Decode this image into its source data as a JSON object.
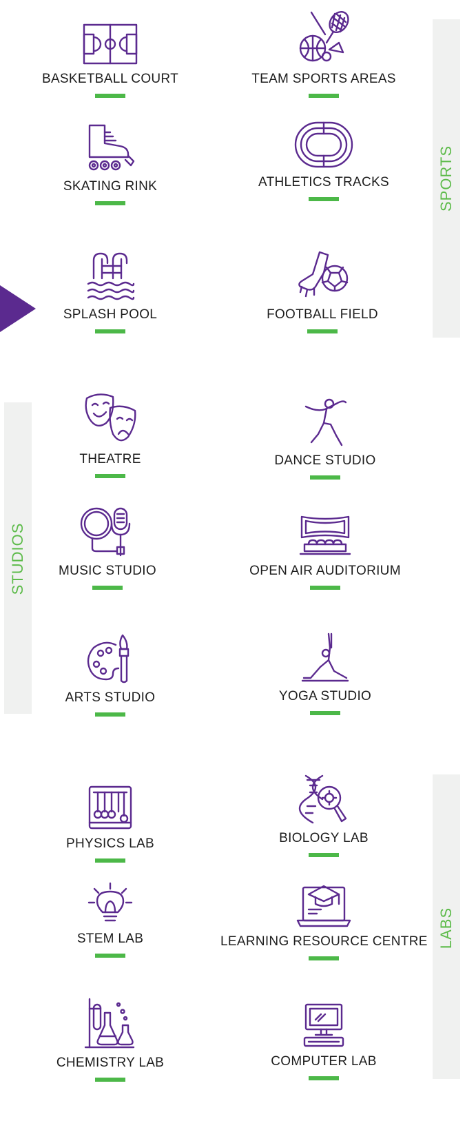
{
  "sections": {
    "sports": "SPORTS",
    "studios": "STUDIOS",
    "labs": "LABS"
  },
  "facilities": {
    "basketball_court": "BASKETBALL COURT",
    "team_sports_areas": "TEAM SPORTS AREAS",
    "skating_rink": "SKATING RINK",
    "athletics_tracks": "ATHLETICS TRACKS",
    "splash_pool": "SPLASH POOL",
    "football_field": "FOOTBALL FIELD",
    "theatre": "THEATRE",
    "dance_studio": "DANCE STUDIO",
    "music_studio": "MUSIC STUDIO",
    "open_air_auditorium": "OPEN AIR AUDITORIUM",
    "arts_studio": "ARTS STUDIO",
    "yoga_studio": "YOGA STUDIO",
    "physics_lab": "PHYSICS LAB",
    "biology_lab": "BIOLOGY LAB",
    "stem_lab": "STEM LAB",
    "learning_resource_centre": "LEARNING RESOURCE CENTRE",
    "chemistry_lab": "CHEMISTRY LAB",
    "computer_lab": "COMPUTER LAB"
  },
  "icons": {
    "basketball_court": "basketball-court-icon",
    "team_sports_areas": "sports-equipment-icon",
    "skating_rink": "roller-skate-icon",
    "athletics_tracks": "running-track-icon",
    "splash_pool": "pool-ladder-icon",
    "football_field": "football-kick-icon",
    "theatre": "theatre-masks-icon",
    "dance_studio": "dancer-icon",
    "music_studio": "microphone-icon",
    "open_air_auditorium": "auditorium-icon",
    "arts_studio": "paint-palette-icon",
    "yoga_studio": "yoga-pose-icon",
    "physics_lab": "newtons-cradle-icon",
    "biology_lab": "dna-magnifier-icon",
    "stem_lab": "light-bulb-icon",
    "learning_resource_centre": "laptop-graduation-icon",
    "chemistry_lab": "lab-flasks-icon",
    "computer_lab": "desktop-computer-icon"
  },
  "colors": {
    "icon_purple": "#5b2a8f",
    "accent_green": "#4cb848",
    "section_text_green": "#5dbb4a",
    "band_grey": "#f0f1f0"
  }
}
